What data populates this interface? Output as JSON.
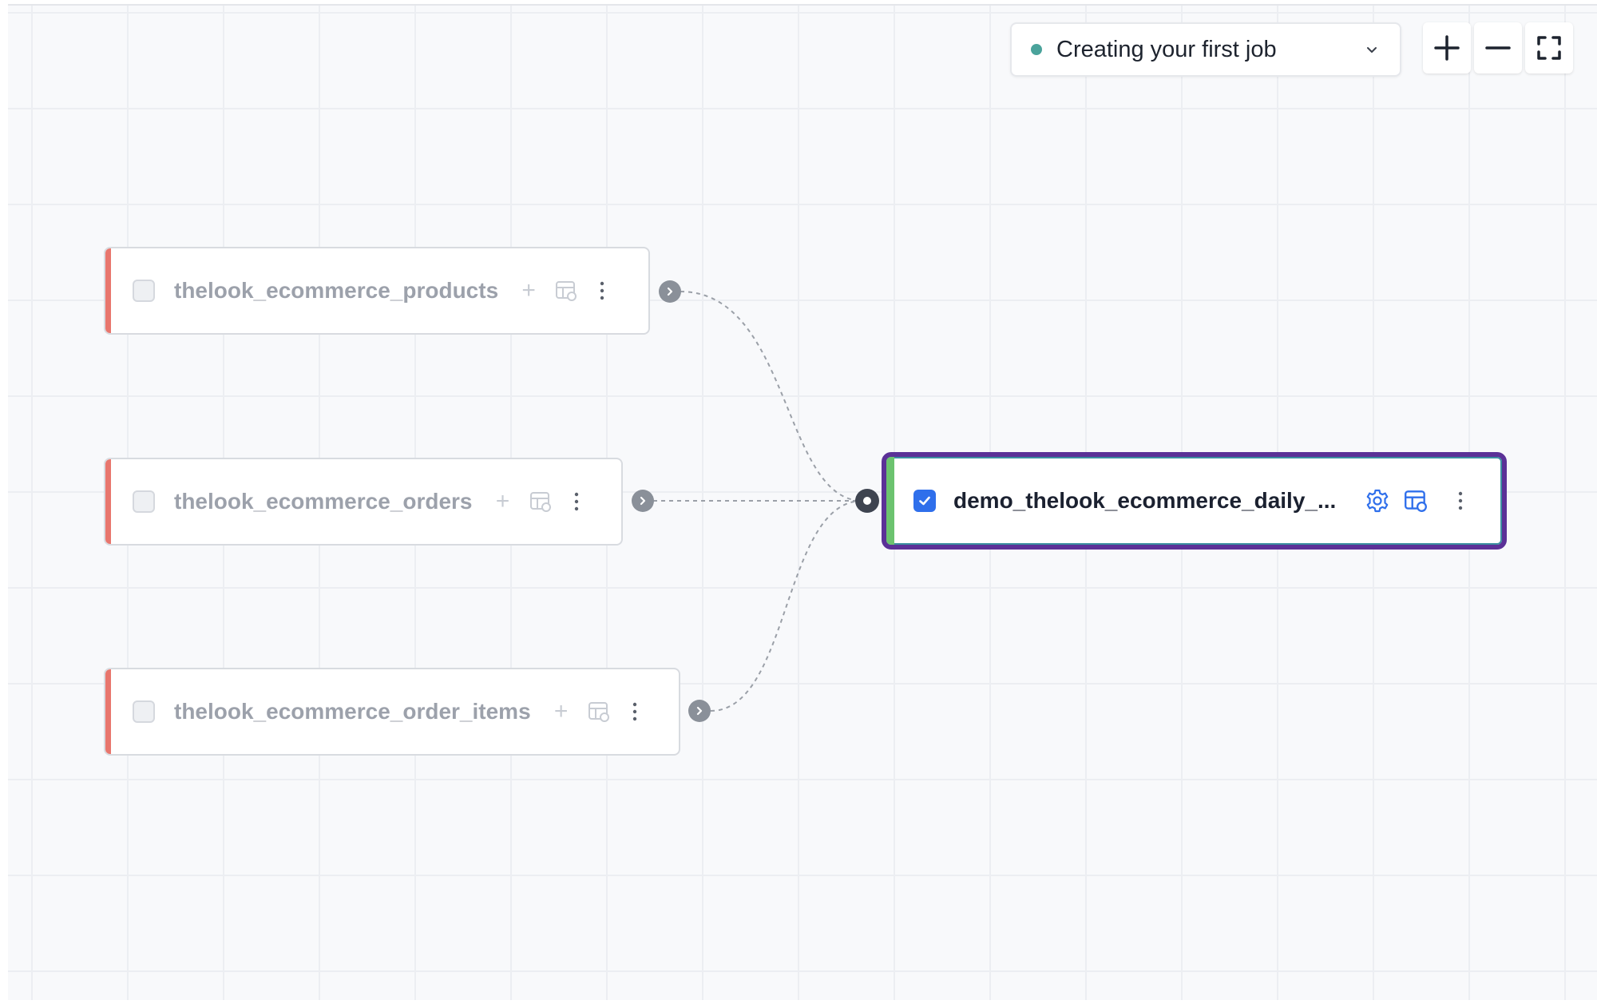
{
  "toolbar": {
    "job_select_label": "Creating your first job",
    "job_status_color": "#4aa39b",
    "zoom_in_icon": "plus-icon",
    "zoom_out_icon": "minus-icon",
    "fit_view_icon": "fullscreen-icon"
  },
  "graph": {
    "sources": [
      {
        "name": "thelook_ecommerce_products",
        "status_color": "#e8766d",
        "selected": false
      },
      {
        "name": "thelook_ecommerce_orders",
        "status_color": "#e8766d",
        "selected": false
      },
      {
        "name": "thelook_ecommerce_order_items",
        "status_color": "#e8766d",
        "selected": false
      }
    ],
    "target": {
      "name": "demo_thelook_ecommerce_daily_...",
      "status_color": "#6cc36f",
      "selected": true,
      "accent_color": "#2f6feb"
    },
    "edges": [
      {
        "from": "thelook_ecommerce_products",
        "to": "demo_thelook_ecommerce_daily_..."
      },
      {
        "from": "thelook_ecommerce_orders",
        "to": "demo_thelook_ecommerce_daily_..."
      },
      {
        "from": "thelook_ecommerce_order_items",
        "to": "demo_thelook_ecommerce_daily_..."
      }
    ]
  },
  "icons": {
    "add": "plus-icon",
    "table": "table-sync-icon",
    "menu": "more-vertical-icon",
    "settings": "gear-icon",
    "output": "chevron-right-icon"
  }
}
